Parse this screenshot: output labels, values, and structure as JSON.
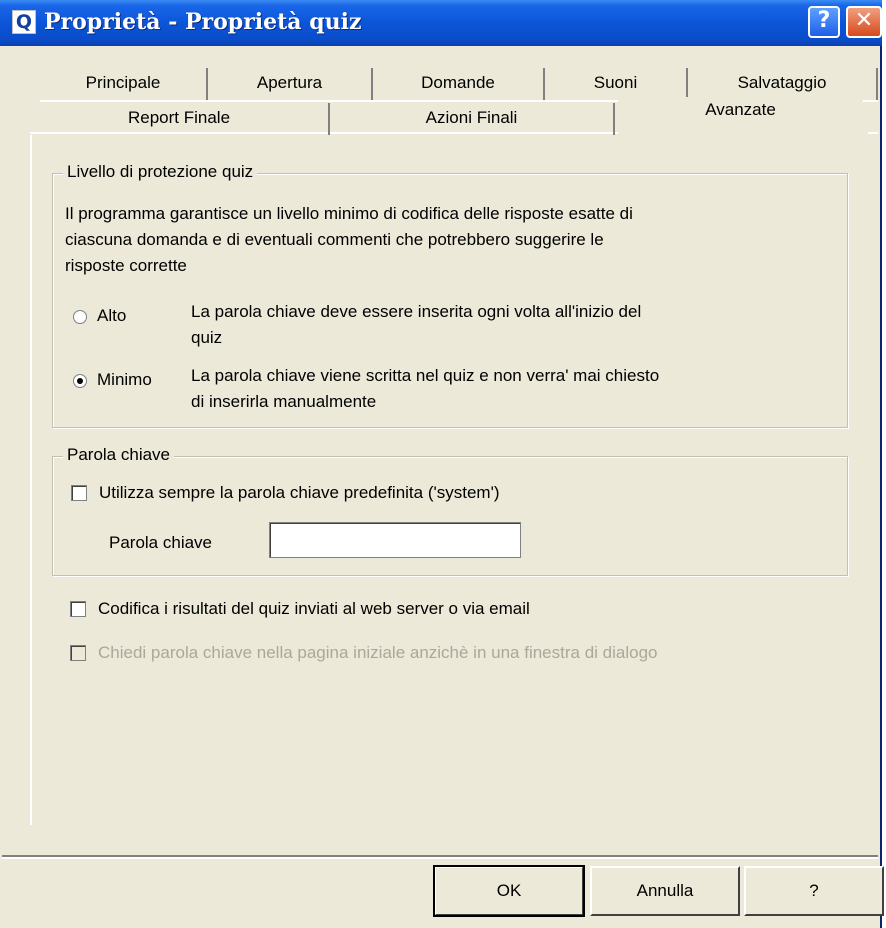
{
  "window": {
    "title": "Proprietà - Proprietà quiz",
    "icon": "Q",
    "help_glyph": "?",
    "close_glyph": "✕"
  },
  "tabs": {
    "row1": [
      "Principale",
      "Apertura",
      "Domande",
      "Suoni",
      "Salvataggio"
    ],
    "row2": [
      "Report Finale",
      "Azioni Finali",
      "Avanzate"
    ],
    "active": "Avanzate"
  },
  "protection": {
    "legend": "Livello di protezione quiz",
    "description": [
      "Il programma garantisce un livello minimo di codifica delle risposte esatte di",
      "ciascuna domanda e di eventuali commenti che potrebbero suggerire le",
      "risposte corrette"
    ],
    "options": [
      {
        "label": "Alto",
        "desc": [
          "La parola chiave deve essere inserita ogni volta all'inizio del",
          "quiz"
        ],
        "checked": false
      },
      {
        "label": "Minimo",
        "desc": [
          "La parola chiave viene scritta nel quiz e non verra' mai chiesto",
          "di inserirla manualmente"
        ],
        "checked": true
      }
    ]
  },
  "password": {
    "legend": "Parola chiave",
    "default_checkbox_label": "Utilizza sempre la parola chiave predefinita ('system')",
    "field_label": "Parola chiave",
    "field_value": ""
  },
  "options": {
    "encode_label": "Codifica i risultati del quiz inviati al web server o via email",
    "ask_label": "Chiedi parola chiave nella pagina iniziale anzichè in una finestra di dialogo"
  },
  "buttons": {
    "ok": "OK",
    "cancel": "Annulla",
    "help": "?"
  }
}
